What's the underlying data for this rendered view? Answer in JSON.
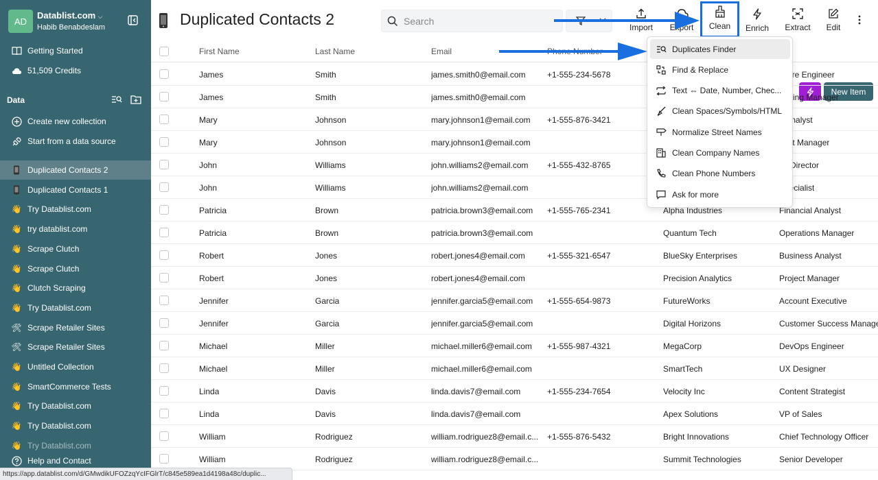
{
  "sidebar": {
    "avatar_initials": "AD",
    "workspace_name": "Datablist.com",
    "user_name": "Habib Benabdeslam",
    "getting_started": "Getting Started",
    "credits": "51,509 Credits",
    "data_header": "Data",
    "create_collection": "Create new collection",
    "start_source": "Start from a data source",
    "collections": [
      {
        "label": "Duplicated Contacts 2",
        "icon": "phone-icon",
        "active": true
      },
      {
        "label": "Duplicated Contacts 1",
        "icon": "phone-icon",
        "active": false
      },
      {
        "label": "Try Datablist.com",
        "icon": "wave-hand-icon",
        "active": false
      },
      {
        "label": "try datablist.com",
        "icon": "wave-hand-icon",
        "active": false
      },
      {
        "label": "Scrape Clutch",
        "icon": "wave-hand-icon",
        "active": false
      },
      {
        "label": "Scrape Clutch",
        "icon": "wave-hand-icon",
        "active": false
      },
      {
        "label": "Clutch Scraping",
        "icon": "wave-hand-icon",
        "active": false
      },
      {
        "label": "Try Datablist.com",
        "icon": "wave-hand-icon",
        "active": false
      },
      {
        "label": "Scrape Retailer Sites",
        "icon": "tools-icon",
        "active": false
      },
      {
        "label": "Scrape Retailer Sites",
        "icon": "tools-icon",
        "active": false
      },
      {
        "label": "Untitled Collection",
        "icon": "wave-hand-icon",
        "active": false
      },
      {
        "label": "SmartCommerce Tests",
        "icon": "wave-hand-icon",
        "active": false
      },
      {
        "label": "Try Datablist.com",
        "icon": "wave-hand-icon",
        "active": false
      },
      {
        "label": "Try Datablist.com",
        "icon": "wave-hand-icon",
        "active": false
      },
      {
        "label": "Try Datablist.com",
        "icon": "wave-hand-icon",
        "active": false
      }
    ],
    "help": "Help and Contact"
  },
  "header": {
    "title": "Duplicated Contacts 2",
    "search_placeholder": "Search"
  },
  "toolbar": {
    "import": "Import",
    "export": "Export",
    "clean": "Clean",
    "enrich": "Enrich",
    "extract": "Extract",
    "edit": "Edit"
  },
  "table": {
    "columns": [
      "First Name",
      "Last Name",
      "Email",
      "Phone Number"
    ],
    "rows": [
      {
        "first": "James",
        "last": "Smith",
        "email": "james.smith0@email.com",
        "phone": "+1-555-234-5678",
        "company": "",
        "title": "tware Engineer"
      },
      {
        "first": "James",
        "last": "Smith",
        "email": "james.smith0@email.com",
        "phone": "",
        "company": "",
        "title": "rketing Manager"
      },
      {
        "first": "Mary",
        "last": "Johnson",
        "email": "mary.johnson1@email.com",
        "phone": "+1-555-876-3421",
        "company": "",
        "title": "a Analyst"
      },
      {
        "first": "Mary",
        "last": "Johnson",
        "email": "mary.johnson1@email.com",
        "phone": "",
        "company": "",
        "title": "duct Manager"
      },
      {
        "first": "John",
        "last": "Williams",
        "email": "john.williams2@email.com",
        "phone": "+1-555-432-8765",
        "company": "",
        "title": "es Director"
      },
      {
        "first": "John",
        "last": "Williams",
        "email": "john.williams2@email.com",
        "phone": "",
        "company": "",
        "title": "Specialist"
      },
      {
        "first": "Patricia",
        "last": "Brown",
        "email": "patricia.brown3@email.com",
        "phone": "+1-555-765-2341",
        "company": "Alpha Industries",
        "title": "Financial Analyst"
      },
      {
        "first": "Patricia",
        "last": "Brown",
        "email": "patricia.brown3@email.com",
        "phone": "",
        "company": "Quantum Tech",
        "title": "Operations Manager"
      },
      {
        "first": "Robert",
        "last": "Jones",
        "email": "robert.jones4@email.com",
        "phone": "+1-555-321-6547",
        "company": "BlueSky Enterprises",
        "title": "Business Analyst"
      },
      {
        "first": "Robert",
        "last": "Jones",
        "email": "robert.jones4@email.com",
        "phone": "",
        "company": "Precision Analytics",
        "title": "Project Manager"
      },
      {
        "first": "Jennifer",
        "last": "Garcia",
        "email": "jennifer.garcia5@email.com",
        "phone": "+1-555-654-9873",
        "company": "FutureWorks",
        "title": "Account Executive"
      },
      {
        "first": "Jennifer",
        "last": "Garcia",
        "email": "jennifer.garcia5@email.com",
        "phone": "",
        "company": "Digital Horizons",
        "title": "Customer Success Manage"
      },
      {
        "first": "Michael",
        "last": "Miller",
        "email": "michael.miller6@email.com",
        "phone": "+1-555-987-4321",
        "company": "MegaCorp",
        "title": "DevOps Engineer"
      },
      {
        "first": "Michael",
        "last": "Miller",
        "email": "michael.miller6@email.com",
        "phone": "",
        "company": "SmartTech",
        "title": "UX Designer"
      },
      {
        "first": "Linda",
        "last": "Davis",
        "email": "linda.davis7@email.com",
        "phone": "+1-555-234-7654",
        "company": "Velocity Inc",
        "title": "Content Strategist"
      },
      {
        "first": "Linda",
        "last": "Davis",
        "email": "linda.davis7@email.com",
        "phone": "",
        "company": "Apex Solutions",
        "title": "VP of Sales"
      },
      {
        "first": "William",
        "last": "Rodriguez",
        "email": "william.rodriguez8@email.c...",
        "phone": "+1-555-876-5432",
        "company": "Bright Innovations",
        "title": "Chief Technology Officer"
      },
      {
        "first": "William",
        "last": "Rodriguez",
        "email": "william.rodriguez8@email.c...",
        "phone": "",
        "company": "Summit Technologies",
        "title": "Senior Developer"
      }
    ]
  },
  "clean_menu": [
    {
      "label": "Duplicates Finder",
      "icon": "duplicates-icon",
      "active": true
    },
    {
      "label": "Find & Replace",
      "icon": "find-replace-icon",
      "active": false
    },
    {
      "label": "Text ⇔ Date, Number, Chec...",
      "icon": "convert-icon",
      "active": false
    },
    {
      "label": "Clean Spaces/Symbols/HTML",
      "icon": "broom-icon",
      "active": false
    },
    {
      "label": "Normalize Street Names",
      "icon": "street-sign-icon",
      "active": false
    },
    {
      "label": "Clean Company Names",
      "icon": "building-icon",
      "active": false
    },
    {
      "label": "Clean Phone Numbers",
      "icon": "phone-handset-icon",
      "active": false
    },
    {
      "label": "Ask for more",
      "icon": "chat-icon",
      "active": false
    }
  ],
  "new_item": "New Item",
  "status_url": "https://app.datablist.com/d/GMwdikUFOZzqYcIFGlrT/c845e589ea1d4198a48c/duplic...",
  "colors": {
    "sidebar": "#386670",
    "accent_purple": "#a11ed5",
    "highlight_blue": "#1a6fe0"
  }
}
